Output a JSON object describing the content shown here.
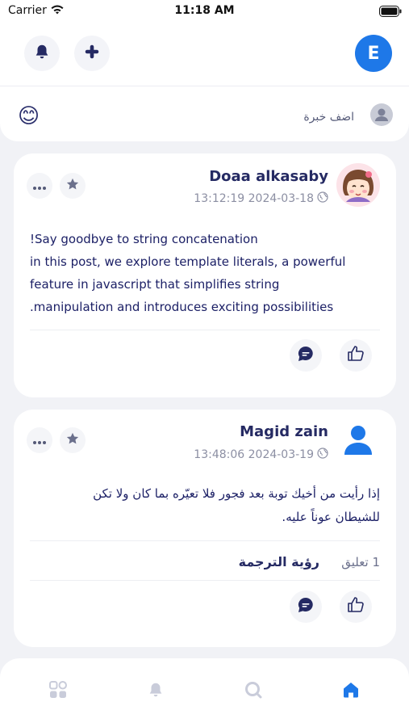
{
  "status_bar": {
    "carrier": "Carrier",
    "time": "11:18 AM"
  },
  "header": {
    "user_initial": "E",
    "icons": [
      "bell-icon",
      "plus-icon"
    ]
  },
  "composer": {
    "label": "اضف خبرة",
    "emoji": "😊"
  },
  "posts": [
    {
      "author": "Doaa alkasaby",
      "date": "13:12:19 2024-03-18",
      "body_lines": [
        "!Say goodbye to string concatenation",
        "in this post, we explore template literals, a powerful",
        "feature in javascript that simplifies string",
        ".manipulation and introduces exciting possibilities"
      ]
    },
    {
      "author": "Magid zain",
      "date": "13:48:06 2024-03-19",
      "body_lines": [
        "إذا رأيت من أخيك توبة بعد فجور  فلا تعيّره بما كان ولا تكن",
        "للشيطان عوناً عليه."
      ],
      "comments_count": "1 تعليق",
      "translate_label": "رؤية الترجمة"
    }
  ],
  "bottom_nav": {
    "items": [
      "apps-icon",
      "bell-icon",
      "search-icon",
      "home-icon"
    ],
    "active": "home-icon",
    "accent": "#1E78E8",
    "inactive": "#C9CCDA"
  },
  "colors": {
    "brand": "#1E78E8",
    "navy": "#252A63",
    "background": "#F1F2F6"
  }
}
